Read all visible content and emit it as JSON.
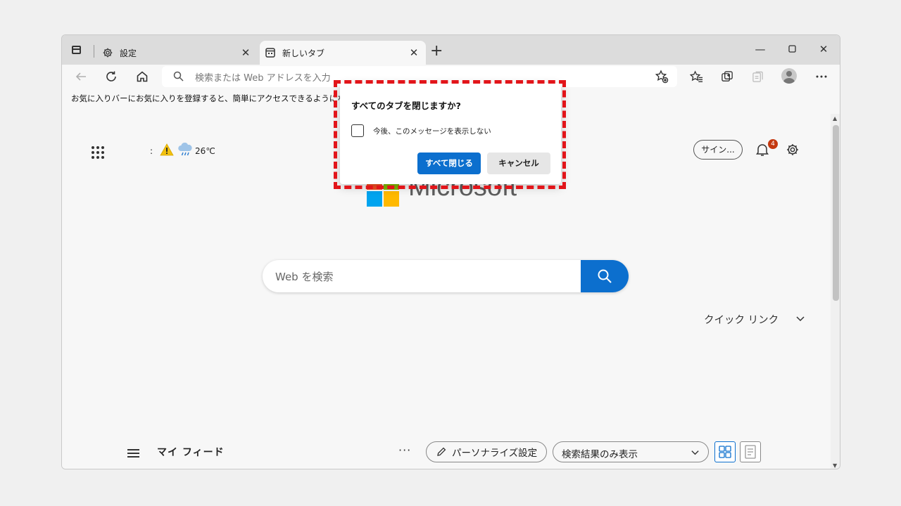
{
  "tabs": [
    {
      "label": "設定",
      "icon": "gear-icon"
    },
    {
      "label": "新しいタブ",
      "icon": "newtab-icon"
    }
  ],
  "address": {
    "placeholder": "検索または Web アドレスを入力"
  },
  "favorites_bar": {
    "message": "お気に入りバーにお気に入りを登録すると、簡単にアクセスできるようになります。"
  },
  "weather": {
    "prefix": ":",
    "temp": "26℃"
  },
  "header": {
    "signin_label": "サイン...",
    "notification_count": "4"
  },
  "brand": {
    "wordmark": "Microsoft"
  },
  "search": {
    "placeholder": "Web を検索"
  },
  "quick_links": {
    "label": "クイック リンク"
  },
  "feed": {
    "title": "マイ フィード",
    "more": "···",
    "personalize_label": "パーソナライズ設定",
    "filter_label": "検索結果のみ表示"
  },
  "dialog": {
    "title": "すべてのタブを閉じますか?",
    "checkbox_label": "今後、このメッセージを表示しない",
    "confirm_label": "すべて閉じる",
    "cancel_label": "キャンセル"
  },
  "colors": {
    "accent": "#0c6fce",
    "highlight": "#e2151a",
    "badge": "#c4380f"
  }
}
